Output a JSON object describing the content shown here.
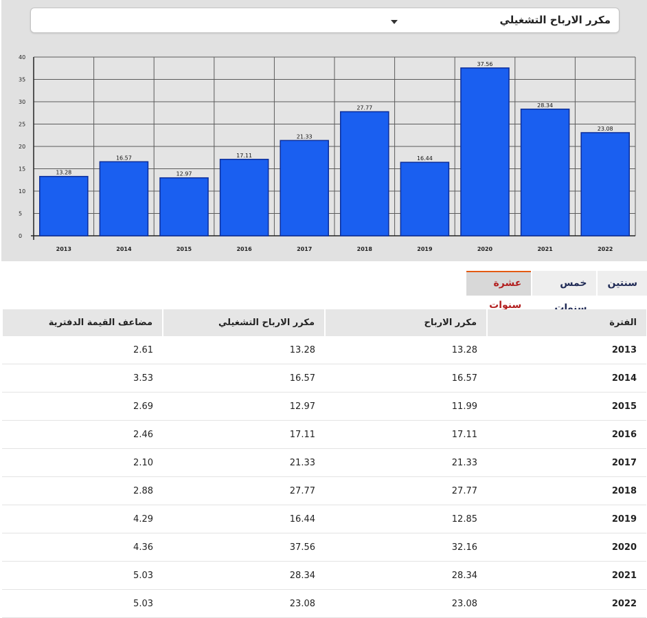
{
  "metric_select": {
    "selected": "مكرر الارباح التشغيلي"
  },
  "chart_data": {
    "type": "bar",
    "categories": [
      "2013",
      "2014",
      "2015",
      "2016",
      "2017",
      "2018",
      "2019",
      "2020",
      "2021",
      "2022"
    ],
    "values": [
      13.28,
      16.57,
      12.97,
      17.11,
      21.33,
      27.77,
      16.44,
      37.56,
      28.34,
      23.08
    ],
    "data_labels": [
      "13.28",
      "16.57",
      "12.97",
      "17.11",
      "21.33",
      "27.77",
      "16.44",
      "37.56",
      "28.34",
      "23.08"
    ],
    "yticks": [
      "0",
      "5",
      "10",
      "15",
      "20",
      "25",
      "30",
      "35",
      "40"
    ],
    "ylim": [
      0,
      40
    ],
    "grid": true,
    "bar_color": "#1a5ff0",
    "bar_edge_color": "#0b2d9a",
    "title": "",
    "xlabel": "",
    "ylabel": ""
  },
  "tabs": [
    {
      "label": "سنتين",
      "active": false
    },
    {
      "label": "خمس سنوات",
      "active": false
    },
    {
      "label": "عشرة سنوات",
      "active": true
    }
  ],
  "table": {
    "headers": [
      "الفترة",
      "مكرر الارباح",
      "مكرر الارباح التشغيلي",
      "مضاعف القيمة الدفترية"
    ],
    "rows": [
      [
        "2013",
        "13.28",
        "13.28",
        "2.61"
      ],
      [
        "2014",
        "16.57",
        "16.57",
        "3.53"
      ],
      [
        "2015",
        "11.99",
        "12.97",
        "2.69"
      ],
      [
        "2016",
        "17.11",
        "17.11",
        "2.46"
      ],
      [
        "2017",
        "21.33",
        "21.33",
        "2.10"
      ],
      [
        "2018",
        "27.77",
        "27.77",
        "2.88"
      ],
      [
        "2019",
        "12.85",
        "16.44",
        "4.29"
      ],
      [
        "2020",
        "32.16",
        "37.56",
        "4.36"
      ],
      [
        "2021",
        "28.34",
        "28.34",
        "5.03"
      ],
      [
        "2022",
        "23.08",
        "23.08",
        "5.03"
      ]
    ]
  },
  "colors": {
    "accent_tab": "#b21f1f",
    "tab_border": "#e35a12",
    "panel_bg": "#e1e1e1"
  }
}
